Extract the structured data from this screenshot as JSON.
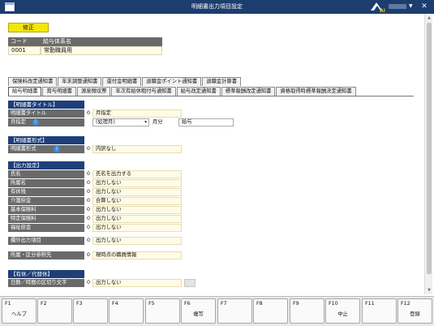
{
  "titlebar": {
    "title": "明細書出力項目設定"
  },
  "toolbar": {
    "edit_label": "修正"
  },
  "header_table": {
    "col_code": "コード",
    "col_name": "給与体系名",
    "code": "0001",
    "name": "常勤職員用"
  },
  "tabs_row1": [
    "保険料改定通知書",
    "年末調整通知書",
    "還付金明細書",
    "退職金ポイント通知書",
    "退職金計算書"
  ],
  "tabs_row2": [
    "給与明細書",
    "賞与明細書",
    "源泉徴収票",
    "年次有給休暇付与通知書",
    "給与改定通知書",
    "標準報酬改定通知書",
    "資格取得時標準報酬決定通知書"
  ],
  "sections": {
    "title": {
      "header": "【明細書タイトル】",
      "row1": {
        "label": "明細書タイトル",
        "code": "0",
        "value": "月指定"
      },
      "row2": {
        "label": "月指定",
        "select": "(処理月)",
        "unit": "月分",
        "text": "給与"
      }
    },
    "format": {
      "header": "【明細書形式】",
      "row": {
        "label": "明細書形式",
        "code": "0",
        "value": "内訳なし"
      }
    },
    "output": {
      "header": "【出力設定】",
      "rows": [
        {
          "label": "氏名",
          "code": "0",
          "value": "氏名を出力する"
        },
        {
          "label": "所属名",
          "code": "0",
          "value": "出力しない"
        },
        {
          "label": "有休残",
          "code": "0",
          "value": "出力しない"
        },
        {
          "label": "介護掛金",
          "code": "0",
          "value": "合算しない"
        },
        {
          "label": "基本保険料",
          "code": "0",
          "value": "出力しない"
        },
        {
          "label": "特定保険料",
          "code": "0",
          "value": "出力しない"
        },
        {
          "label": "福祉掛金",
          "code": "0",
          "value": "出力しない"
        }
      ],
      "extra1": {
        "label": "欄外出力項目",
        "code": "0",
        "value": "出力しない"
      },
      "extra2": {
        "label": "所属・区分参照先",
        "code": "0",
        "value": "現時点の職員情報"
      }
    },
    "holiday": {
      "header": "【有休／代替休】",
      "row": {
        "label": "日数／時間の区切り文字",
        "code": "0",
        "value": "出力しない"
      }
    }
  },
  "fkeys": [
    {
      "key": "F1",
      "label": "ヘルプ"
    },
    {
      "key": "F2",
      "label": ""
    },
    {
      "key": "F3",
      "label": ""
    },
    {
      "key": "F4",
      "label": ""
    },
    {
      "key": "F5",
      "label": ""
    },
    {
      "key": "F6",
      "label": "複写"
    },
    {
      "key": "F7",
      "label": ""
    },
    {
      "key": "F8",
      "label": ""
    },
    {
      "key": "F9",
      "label": ""
    },
    {
      "key": "F10",
      "label": "中止"
    },
    {
      "key": "F11",
      "label": ""
    },
    {
      "key": "F12",
      "label": "登録"
    }
  ]
}
